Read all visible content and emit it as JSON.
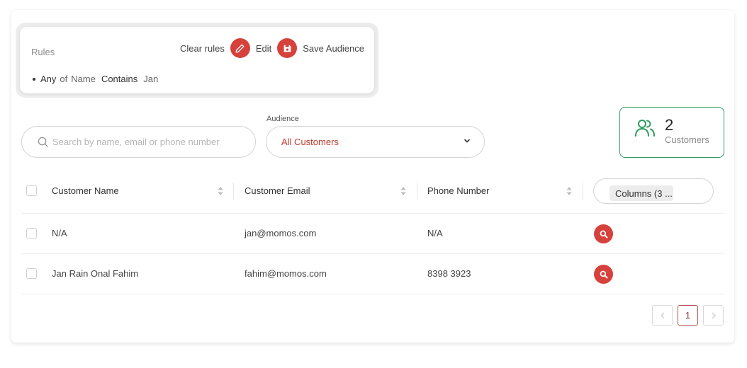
{
  "rules": {
    "title": "Rules",
    "clear_label": "Clear rules",
    "edit_label": "Edit",
    "save_label": "Save Audience",
    "rule": {
      "quantifier": "Any",
      "of": "of",
      "field": "Name",
      "operator": "Contains",
      "value": "Jan"
    }
  },
  "search": {
    "placeholder": "Search by name, email or phone number"
  },
  "audience": {
    "label": "Audience",
    "selected": "All Customers"
  },
  "summary": {
    "count": "2",
    "label": "Customers"
  },
  "table": {
    "columns": [
      "Customer Name",
      "Customer Email",
      "Phone Number"
    ],
    "columns_button": "Columns (3 ...",
    "rows": [
      {
        "name": "N/A",
        "email": "jan@momos.com",
        "phone": "N/A"
      },
      {
        "name": "Jan Rain Onal Fahim",
        "email": "fahim@momos.com",
        "phone": "8398 3923"
      }
    ]
  },
  "pagination": {
    "current": "1"
  },
  "colors": {
    "accent": "#d6413b",
    "success": "#2e9c5e"
  }
}
